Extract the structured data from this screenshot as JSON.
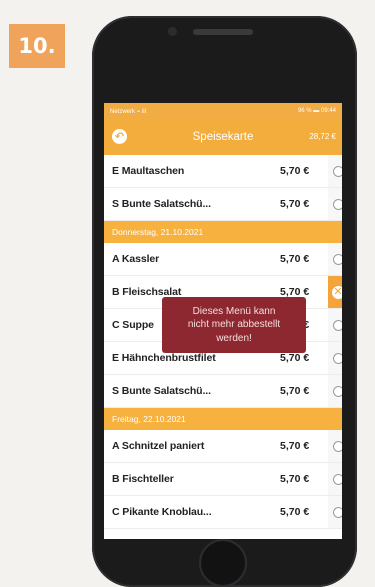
{
  "step_badge": "10.",
  "statusbar": {
    "left": "Netzwerk  ⌁ ill",
    "right": "96 % ▬ 09:44"
  },
  "appbar": {
    "title": "Speisekarte",
    "balance": "28,72 €",
    "back_icon": "back-arrow-icon"
  },
  "sections": [
    {
      "rows": [
        {
          "name": "E Maultaschen",
          "price": "5,70 €",
          "state": "radio"
        },
        {
          "name": "S Bunte Salatschü...",
          "price": "5,70 €",
          "state": "radio"
        }
      ]
    },
    {
      "header": "Donnerstag, 21.10.2021",
      "rows": [
        {
          "name": "A Kassler",
          "price": "5,70 €",
          "state": "radio"
        },
        {
          "name": "B Fleischsalat",
          "price": "5,70 €",
          "state": "cancel"
        },
        {
          "name": "C Suppe",
          "price": "5,70 €",
          "state": "radio"
        },
        {
          "name": "E Hähnchenbrustfilet",
          "price": "5,70 €",
          "state": "radio"
        },
        {
          "name": "S Bunte Salatschü...",
          "price": "5,70 €",
          "state": "radio"
        }
      ]
    },
    {
      "header": "Freitag, 22.10.2021",
      "rows": [
        {
          "name": "A Schnitzel paniert",
          "price": "5,70 €",
          "state": "radio"
        },
        {
          "name": "B Fischteller",
          "price": "5,70 €",
          "state": "radio"
        },
        {
          "name": "C Pikante Knoblau...",
          "price": "5,70 €",
          "state": "radio"
        }
      ]
    }
  ],
  "toast": "Dieses Menü kann\nnicht mehr abbestellt\nwerden!",
  "colors": {
    "accent": "#f2ad3c",
    "badge": "#f0a35a",
    "toast": "#8e2830"
  }
}
